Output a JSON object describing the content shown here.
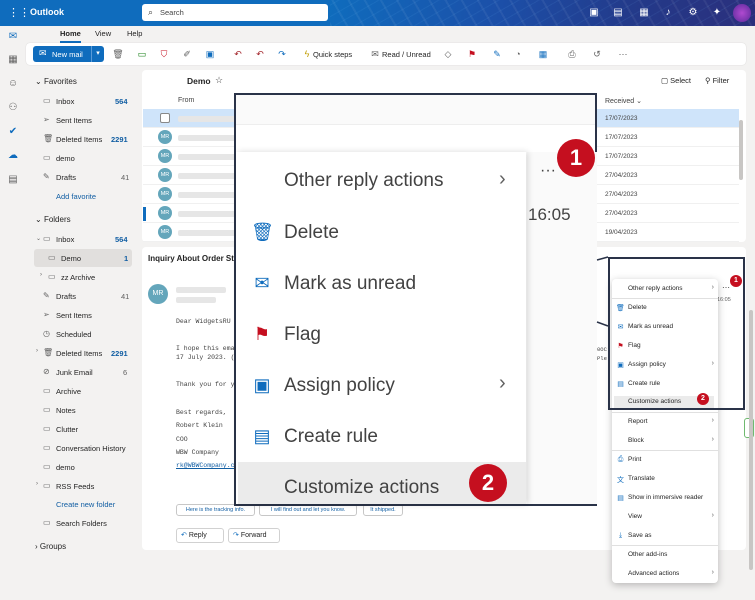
{
  "topbar": {
    "app_title": "Outlook",
    "search_placeholder": "Search"
  },
  "tabs": [
    "Home",
    "View",
    "Help"
  ],
  "toolbar": {
    "new_mail": "New mail",
    "quick_steps": "Quick steps",
    "read_unread": "Read / Unread"
  },
  "folders": {
    "favorites_header": "Favorites",
    "favorites": [
      {
        "label": "Inbox",
        "count": "564"
      },
      {
        "label": "Sent Items",
        "count": ""
      },
      {
        "label": "Deleted Items",
        "count": "2291"
      },
      {
        "label": "demo",
        "count": ""
      },
      {
        "label": "Drafts",
        "count": "41"
      }
    ],
    "add_favorite": "Add favorite",
    "folders_header": "Folders",
    "items": [
      {
        "label": "Inbox",
        "count": "564"
      },
      {
        "label": "Demo",
        "count": "1"
      },
      {
        "label": "zz Archive",
        "count": ""
      },
      {
        "label": "Drafts",
        "count": "41"
      },
      {
        "label": "Sent Items",
        "count": ""
      },
      {
        "label": "Scheduled",
        "count": ""
      },
      {
        "label": "Deleted Items",
        "count": "2291"
      },
      {
        "label": "Junk Email",
        "count": "6"
      },
      {
        "label": "Archive",
        "count": ""
      },
      {
        "label": "Notes",
        "count": ""
      },
      {
        "label": "Clutter",
        "count": ""
      },
      {
        "label": "Conversation History",
        "count": ""
      },
      {
        "label": "demo",
        "count": ""
      },
      {
        "label": "RSS Feeds",
        "count": ""
      }
    ],
    "create_new_folder": "Create new folder",
    "search_folders": "Search Folders",
    "groups_header": "Groups"
  },
  "message_list": {
    "title": "Demo",
    "select": "Select",
    "filter": "Filter",
    "col_from": "From",
    "col_received": "Received",
    "rows": [
      {
        "avatar": "",
        "date": "17/07/2023"
      },
      {
        "avatar": "MR",
        "date": "17/07/2023"
      },
      {
        "avatar": "MR",
        "date": "17/07/2023"
      },
      {
        "avatar": "MR",
        "date": "27/04/2023"
      },
      {
        "avatar": "MR",
        "date": "27/04/2023"
      },
      {
        "avatar": "MR",
        "date": "27/04/2023"
      },
      {
        "avatar": "MR",
        "date": "19/04/2023"
      }
    ]
  },
  "reading_pane": {
    "subject": "Inquiry About Order St",
    "avatar": "MR",
    "body": {
      "greeting": "Dear WidgetsRU",
      "line1": "I hope this ema",
      "line2": "17 July 2023. (",
      "thanks": "Thank you for y",
      "regards": "Best regards,",
      "name": "Robert Klein",
      "role": "COO",
      "company": "WBW Company",
      "email": "rk@WBWCompany.c"
    },
    "suggestions": [
      "Here is the tracking info.",
      "I will find out and let you know.",
      "It shipped."
    ],
    "reply": "Reply",
    "forward": "Forward",
    "time_fragment": "16:05",
    "body_fragment_1": "0OC",
    "body_fragment_2": "Ple"
  },
  "context_menu": {
    "items": [
      {
        "label": "Other reply actions",
        "arrow": true
      },
      {
        "label": "Delete",
        "arrow": false
      },
      {
        "label": "Mark as unread",
        "arrow": false
      },
      {
        "label": "Flag",
        "arrow": false
      },
      {
        "label": "Assign policy",
        "arrow": true
      },
      {
        "label": "Create rule",
        "arrow": false
      },
      {
        "label": "Customize actions",
        "arrow": false
      },
      {
        "label": "Report",
        "arrow": true
      },
      {
        "label": "Block",
        "arrow": true
      },
      {
        "label": "Print",
        "arrow": false
      },
      {
        "label": "Translate",
        "arrow": false
      },
      {
        "label": "Show in immersive reader",
        "arrow": false
      },
      {
        "label": "View",
        "arrow": true
      },
      {
        "label": "Save as",
        "arrow": false
      },
      {
        "label": "Other add-ins",
        "arrow": false
      },
      {
        "label": "Advanced actions",
        "arrow": true
      }
    ]
  },
  "zoom": {
    "time": "16:05",
    "more": "···",
    "items": [
      "Other reply actions",
      "Delete",
      "Mark as unread",
      "Flag",
      "Assign policy",
      "Create rule",
      "Customize actions"
    ]
  },
  "badges": {
    "one": "1",
    "two": "2"
  },
  "colors": {
    "brand": "#0f6cbd",
    "badge": "#c50f1f",
    "avatar": "#64a6bb"
  }
}
